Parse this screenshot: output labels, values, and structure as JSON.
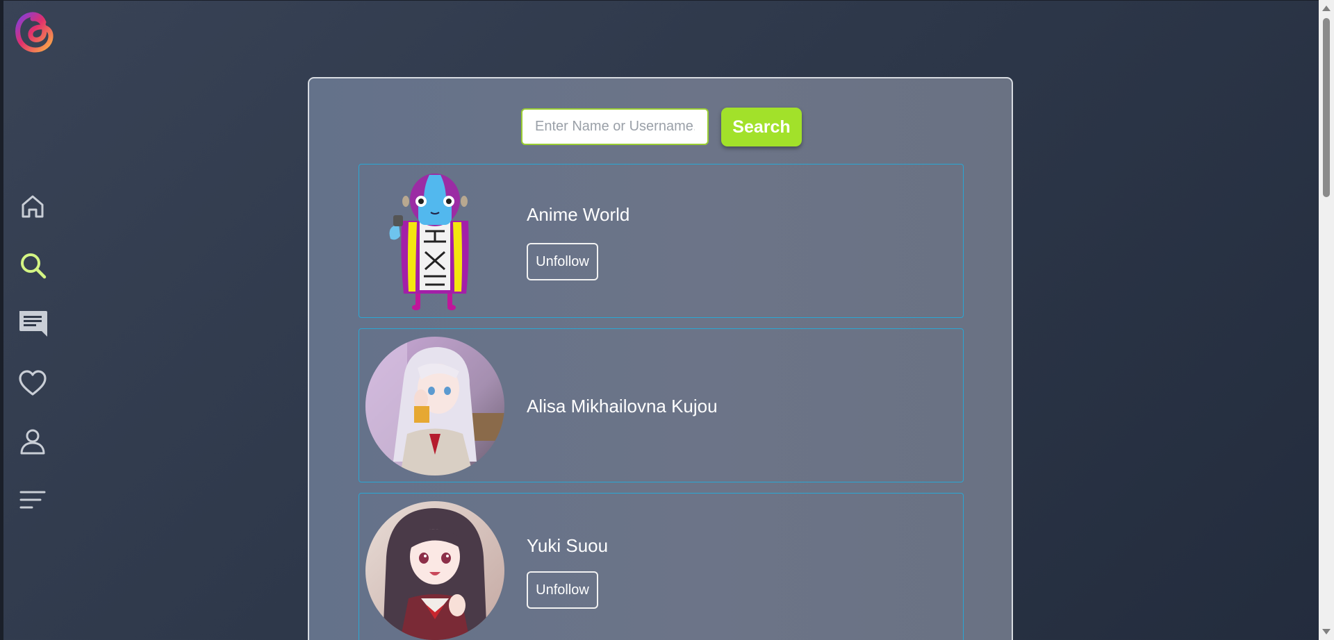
{
  "app": {
    "logo_icon": "threads-logo-icon",
    "accent_color": "#a2e12a"
  },
  "sidebar": {
    "items": [
      {
        "icon": "home-icon",
        "active": false
      },
      {
        "icon": "search-icon",
        "active": true,
        "color": "#d4f584"
      },
      {
        "icon": "chat-icon",
        "active": false
      },
      {
        "icon": "heart-icon",
        "active": false
      },
      {
        "icon": "profile-icon",
        "active": false
      },
      {
        "icon": "menu-icon",
        "active": false
      }
    ]
  },
  "search": {
    "placeholder": "Enter Name or Username.",
    "value": "",
    "button_label": "Search"
  },
  "results": [
    {
      "name": "Anime World",
      "button_label": "Unfollow",
      "avatar": "cartoon-character-avatar"
    },
    {
      "name": "Alisa Mikhailovna Kujou",
      "avatar": "anime-girl-silver-hair-avatar"
    },
    {
      "name": "Yuki Suou",
      "button_label": "Unfollow",
      "avatar": "anime-girl-dark-hair-avatar"
    }
  ]
}
